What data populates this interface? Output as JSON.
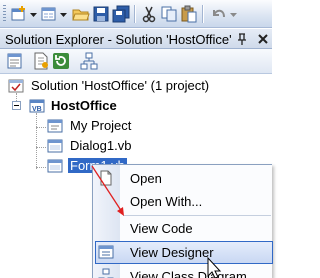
{
  "toolbar": {
    "buttons": [
      "add-project-icon",
      "add-item-icon",
      "open-icon",
      "save-icon",
      "save-all-icon",
      "cut-icon",
      "copy-icon",
      "paste-icon",
      "undo-icon"
    ]
  },
  "panel": {
    "title": "Solution Explorer - Solution 'HostOffice'"
  },
  "pane_toolbar": {
    "buttons": [
      "properties-icon",
      "show-all-files-icon",
      "refresh-icon",
      "class-diagram-icon"
    ]
  },
  "tree": {
    "solution": "Solution 'HostOffice' (1 project)",
    "project": "HostOffice",
    "items": [
      "My Project",
      "Dialog1.vb",
      "Form1.vb"
    ]
  },
  "context_menu": {
    "items": [
      "Open",
      "Open With...",
      "View Code",
      "View Designer",
      "View Class Diagram"
    ],
    "highlighted": "View Designer"
  },
  "colors": {
    "selection": "#3169c6",
    "arrow": "#e02020",
    "menu_highlight": "#c9d8f3"
  }
}
